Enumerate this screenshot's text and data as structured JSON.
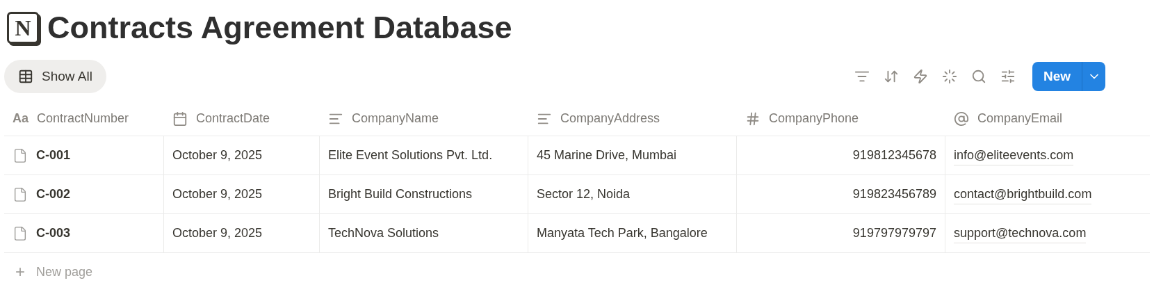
{
  "page": {
    "logo_letter": "N",
    "title": "Contracts Agreement Database"
  },
  "view_tab": {
    "label": "Show All",
    "selected": true
  },
  "toolbar": {
    "new_button": "New"
  },
  "table": {
    "columns": [
      {
        "label": "ContractNumber",
        "kind": "title",
        "glyph": "Aa"
      },
      {
        "label": "ContractDate",
        "kind": "date"
      },
      {
        "label": "CompanyName",
        "kind": "text"
      },
      {
        "label": "CompanyAddress",
        "kind": "text"
      },
      {
        "label": "CompanyPhone",
        "kind": "number"
      },
      {
        "label": "CompanyEmail",
        "kind": "email"
      }
    ],
    "rows": [
      [
        "C-001",
        "October 9, 2025",
        "Elite Event Solutions Pvt. Ltd.",
        "45 Marine Drive, Mumbai",
        "919812345678",
        "info@eliteevents.com"
      ],
      [
        "C-002",
        "October 9, 2025",
        "Bright Build Constructions",
        "Sector 12, Noida",
        "919823456789",
        "contact@brightbuild.com"
      ],
      [
        "C-003",
        "October 9, 2025",
        "TechNova Solutions",
        "Manyata Tech Park, Bangalore",
        "919797979797",
        "support@technova.com"
      ]
    ],
    "new_row": {
      "plus": "+",
      "label": "New page"
    }
  }
}
